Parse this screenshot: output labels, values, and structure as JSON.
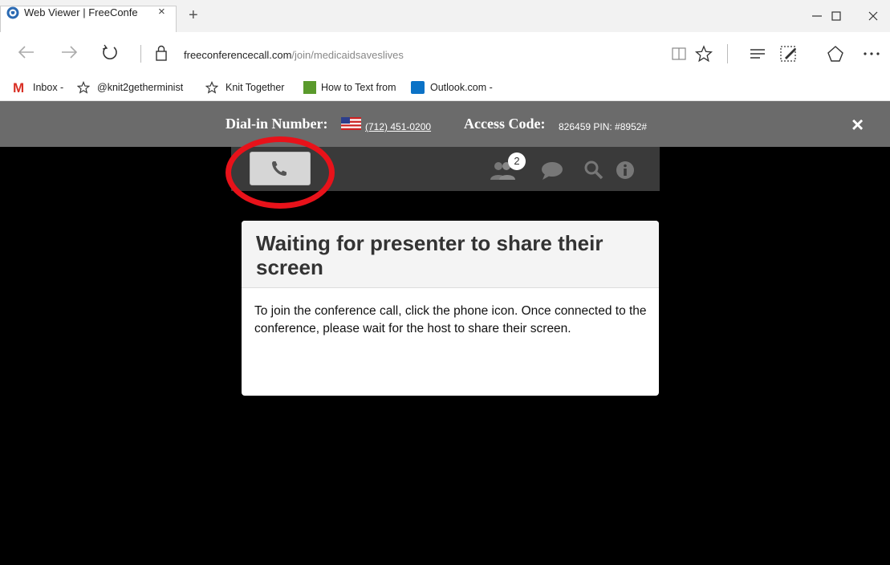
{
  "browser": {
    "tab_title": "Web Viewer | FreeConfe",
    "tab_close": "×",
    "new_tab": "+",
    "url_host": "freeconferencecall.com",
    "url_path": "/join/medicaidsaveslives",
    "window_controls": {
      "minimize": "minimize-icon",
      "maximize": "maximize-icon",
      "close": "close-icon"
    }
  },
  "favorites": [
    {
      "icon": "gmail-icon",
      "label": "Inbox -"
    },
    {
      "icon": "star-icon",
      "label": "@knit2getherminist"
    },
    {
      "icon": "star-icon",
      "label": "Knit Together"
    },
    {
      "icon": "howto-icon",
      "label": "How to Text from"
    },
    {
      "icon": "outlook-icon",
      "label": "Outlook.com -"
    }
  ],
  "header": {
    "dial_label": "Dial-in Number:",
    "dial_number": "(712) 451-0200",
    "access_label": "Access Code:",
    "access_value": "826459 PIN: #8952#",
    "close": "×"
  },
  "toolbar": {
    "participants_count": "2",
    "icons": [
      "phone-icon",
      "participants-icon",
      "chat-icon",
      "search-icon",
      "info-icon"
    ]
  },
  "dialog": {
    "title": "Waiting for presenter to share their screen",
    "body": "To join the conference call, click the phone icon. Once connected to the conference, please wait for the host to share their screen."
  },
  "colors": {
    "annotation": "#e8121a",
    "header_bg": "#6b6b6b",
    "toolbar_bg": "#3a3a3a"
  }
}
